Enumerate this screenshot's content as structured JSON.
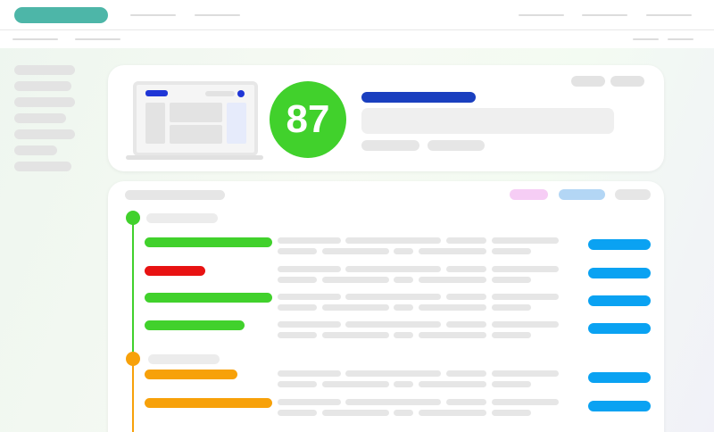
{
  "score": {
    "value": "87",
    "color": "#41d12c"
  },
  "colors": {
    "brand": "#4db6a8",
    "accent_blue": "#1a3fbf",
    "action_blue": "#0aa2f2",
    "status_green": "#41d12c",
    "status_red": "#e81212",
    "status_orange": "#f7a10a",
    "tag_pink": "#f6cdf5",
    "tag_blue": "#b3d6f5"
  },
  "icons": {
    "laptop": "laptop-preview-icon",
    "timeline_good": "timeline-dot-green",
    "timeline_warn": "timeline-dot-orange"
  },
  "groups": [
    {
      "status": "good",
      "color": "#41d12c",
      "rows": [
        {
          "status": "pass",
          "color": "#41d12c"
        },
        {
          "status": "fail",
          "color": "#e81212"
        },
        {
          "status": "pass",
          "color": "#41d12c"
        },
        {
          "status": "pass",
          "color": "#41d12c"
        }
      ]
    },
    {
      "status": "warning",
      "color": "#f7a10a",
      "rows": [
        {
          "status": "warn",
          "color": "#f7a10a"
        },
        {
          "status": "warn",
          "color": "#f7a10a"
        }
      ]
    }
  ]
}
